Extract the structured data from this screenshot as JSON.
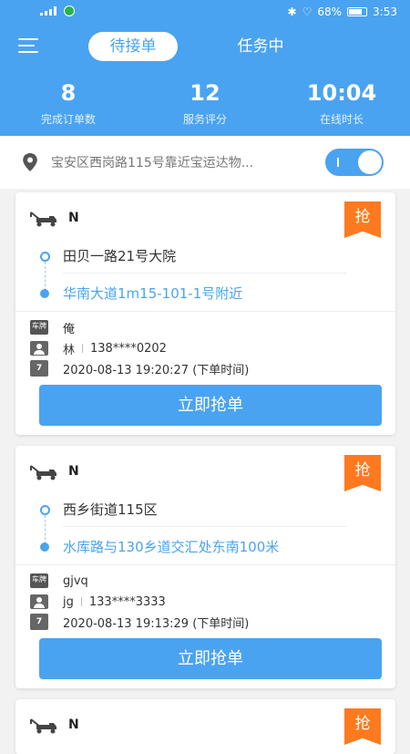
{
  "status_bar": {
    "network": "4G",
    "battery": "68%",
    "time": "3:53",
    "battery_fill_fraction": 0.68
  },
  "header": {
    "tabs": [
      {
        "label": "待接单",
        "active": true
      },
      {
        "label": "任务中",
        "active": false
      }
    ],
    "stats": [
      {
        "value": "8",
        "label": "完成订单数"
      },
      {
        "value": "12",
        "label": "服务评分"
      },
      {
        "value": "10:04",
        "label": "在线时长"
      }
    ]
  },
  "location": {
    "text": "宝安区西岗路115号靠近宝运达物...",
    "toggle_on": true
  },
  "orders": [
    {
      "title": "N",
      "badge": "抢",
      "from": "田贝一路21号大院",
      "to": "华南大道1m15-101-1号附近",
      "plate_icon_label": "车牌",
      "plate": "俺",
      "contact_name": "林",
      "contact_phone": "138****0202",
      "time": "2020-08-13 19:20:27 (下单时间)",
      "button": "立即抢单"
    },
    {
      "title": "N",
      "badge": "抢",
      "from": "西乡街道115区",
      "to": "水库路与130乡道交汇处东南100米",
      "plate_icon_label": "车牌",
      "plate": "gjvq",
      "contact_name": "jg",
      "contact_phone": "133****3333",
      "time": "2020-08-13 19:13:29 (下单时间)",
      "button": "立即抢单"
    },
    {
      "title": "N",
      "badge": "抢"
    }
  ],
  "colors": {
    "primary": "#4aa3f0",
    "badge": "#ff7a1e"
  }
}
